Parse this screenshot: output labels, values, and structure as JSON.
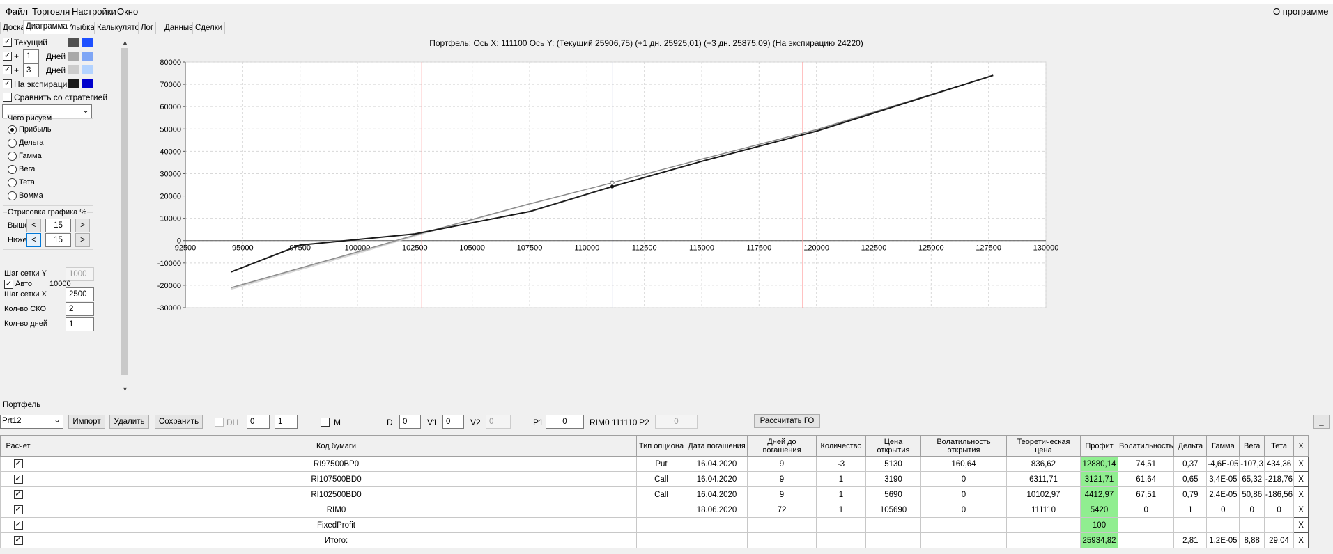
{
  "menu": {
    "items": [
      "Файл",
      "Торговля",
      "Настройки",
      "Окно"
    ],
    "about": "О программе"
  },
  "tabs": [
    "Доска",
    "Диаграмма",
    "Улыбка",
    "Калькулятор",
    "Лог",
    "Данные",
    "Сделки"
  ],
  "left": {
    "current_label": "Текущий",
    "plus_sign": "+",
    "plus1_days": "1",
    "plus3_days": "3",
    "days_label": "Дней",
    "expiry_label": "На экспирацию",
    "compare_label": "Сравнить со стратегией",
    "what_group": "Чего рисуем",
    "radios": [
      "Прибыль",
      "Дельта",
      "Гамма",
      "Вега",
      "Тета",
      "Вомма"
    ],
    "draw_group": "Отрисовка графика %",
    "above_label": "Выше",
    "below_label": "Ниже",
    "above_value": "15",
    "below_value": "15",
    "btn_left": "<",
    "btn_right": ">",
    "ystep_label": "Шаг сетки Y",
    "ystep_value": "1000",
    "auto_label": "Авто",
    "auto_value": "10000",
    "xstep_label": "Шаг сетки X",
    "xstep_value": "2500",
    "sko_label": "Кол-во СКО",
    "sko_value": "2",
    "days_count_label": "Кол-во дней",
    "days_count_value": "1",
    "colors": {
      "current_dark": "#505050",
      "current_accent": "#1e50ff",
      "plus1_dark": "#a8a8a8",
      "plus1_accent": "#7fa6f5",
      "plus3_dark": "#cccccc",
      "plus3_accent": "#b3d3ff",
      "expiry_dark": "#1a1a1a",
      "expiry_accent": "#0000cc"
    }
  },
  "chart_data": {
    "type": "line",
    "title": "Портфель: Ось X: 111100 Ось Y:  (Текущий 25906,75)  (+1 дн. 25925,01)  (+3 дн. 25875,09)  (На экспирацию 24220)",
    "xlim": [
      92500,
      130000
    ],
    "ylim": [
      -30000,
      80000
    ],
    "x_ticks": [
      92500,
      95000,
      97500,
      100000,
      102500,
      105000,
      107500,
      110000,
      112500,
      115000,
      117500,
      120000,
      122500,
      125000,
      127500,
      130000
    ],
    "y_ticks": [
      -30000,
      -20000,
      -10000,
      0,
      10000,
      20000,
      30000,
      40000,
      50000,
      60000,
      70000,
      80000
    ],
    "grid": true,
    "markers": {
      "current_x": 111100,
      "sigma_low": 102800,
      "sigma_high": 119400
    },
    "series": [
      {
        "name": "Текущий",
        "color": "#888888",
        "x": [
          94500,
          100000,
          102500,
          105000,
          107500,
          111100,
          115000,
          120000,
          127700
        ],
        "y": [
          -21000,
          -5000,
          2500,
          9500,
          16500,
          25900,
          36500,
          49700,
          74000
        ]
      },
      {
        "name": "+1 дн.",
        "color": "#bbbbbb",
        "x": [
          94500,
          100000,
          102500,
          105000,
          107500,
          111100,
          115000,
          120000,
          127700
        ],
        "y": [
          -21300,
          -5300,
          2300,
          9400,
          16400,
          25900,
          36500,
          49700,
          74000
        ]
      },
      {
        "name": "+3 дн.",
        "color": "#d8d8d8",
        "x": [
          94500,
          100000,
          102500,
          105000,
          107500,
          111100,
          115000,
          120000,
          127700
        ],
        "y": [
          -21800,
          -5800,
          2000,
          9200,
          16300,
          25900,
          36400,
          49600,
          74000
        ]
      },
      {
        "name": "На экспирацию",
        "color": "#1a1a1a",
        "x": [
          94500,
          97500,
          100000,
          102500,
          105000,
          107500,
          111100,
          115000,
          120000,
          127700
        ],
        "y": [
          -14000,
          -2000,
          500,
          3000,
          8000,
          13000,
          24200,
          35500,
          49000,
          74000
        ]
      }
    ]
  },
  "portfolio": {
    "label": "Портфель",
    "select": "Prt12",
    "import": "Импорт",
    "delete": "Удалить",
    "save": "Сохранить",
    "dh": "DH",
    "spin1": "0",
    "spin2": "1",
    "m": "M",
    "d_label": "D",
    "d_value": "0",
    "v1_label": "V1",
    "v1_value": "0",
    "v2_label": "V2",
    "v2_value": "0",
    "p1_label": "P1",
    "p1_value": "0",
    "rim_label": "RIM0 111110",
    "p2_label": "P2",
    "p2_value": "0",
    "calc_go": "Рассчитать ГО",
    "minimize": "_"
  },
  "table": {
    "headers": [
      "Расчет",
      "Код бумаги",
      "Тип опциона",
      "Дата погашения",
      "Дней до погашения",
      "Количество",
      "Цена открытия",
      "Волатильность открытия",
      "Теоретическая цена",
      "Профит",
      "Волатильность",
      "Дельта",
      "Гамма",
      "Вега",
      "Тета",
      "X"
    ],
    "rows": [
      [
        "✓",
        "RI97500BP0",
        "Put",
        "16.04.2020",
        "9",
        "-3",
        "5130",
        "160,64",
        "836,62",
        "12880,14",
        "74,51",
        "0,37",
        "-4,6E-05",
        "-107,3",
        "434,36",
        "X"
      ],
      [
        "✓",
        "RI107500BD0",
        "Call",
        "16.04.2020",
        "9",
        "1",
        "3190",
        "0",
        "6311,71",
        "3121,71",
        "61,64",
        "0,65",
        "3,4E-05",
        "65,32",
        "-218,76",
        "X"
      ],
      [
        "✓",
        "RI102500BD0",
        "Call",
        "16.04.2020",
        "9",
        "1",
        "5690",
        "0",
        "10102,97",
        "4412,97",
        "67,51",
        "0,79",
        "2,4E-05",
        "50,86",
        "-186,56",
        "X"
      ],
      [
        "✓",
        "RIM0",
        "",
        "18.06.2020",
        "72",
        "1",
        "105690",
        "0",
        "111110",
        "5420",
        "0",
        "1",
        "0",
        "0",
        "0",
        "X"
      ],
      [
        "✓",
        "FixedProfit",
        "",
        "",
        "",
        "",
        "",
        "",
        "",
        "100",
        "",
        "",
        "",
        "",
        "",
        "X"
      ],
      [
        "✓",
        "Итого:",
        "",
        "",
        "",
        "",
        "",
        "",
        "",
        "25934,82",
        "",
        "2,81",
        "1,2E-05",
        "8,88",
        "29,04",
        "X"
      ]
    ]
  }
}
